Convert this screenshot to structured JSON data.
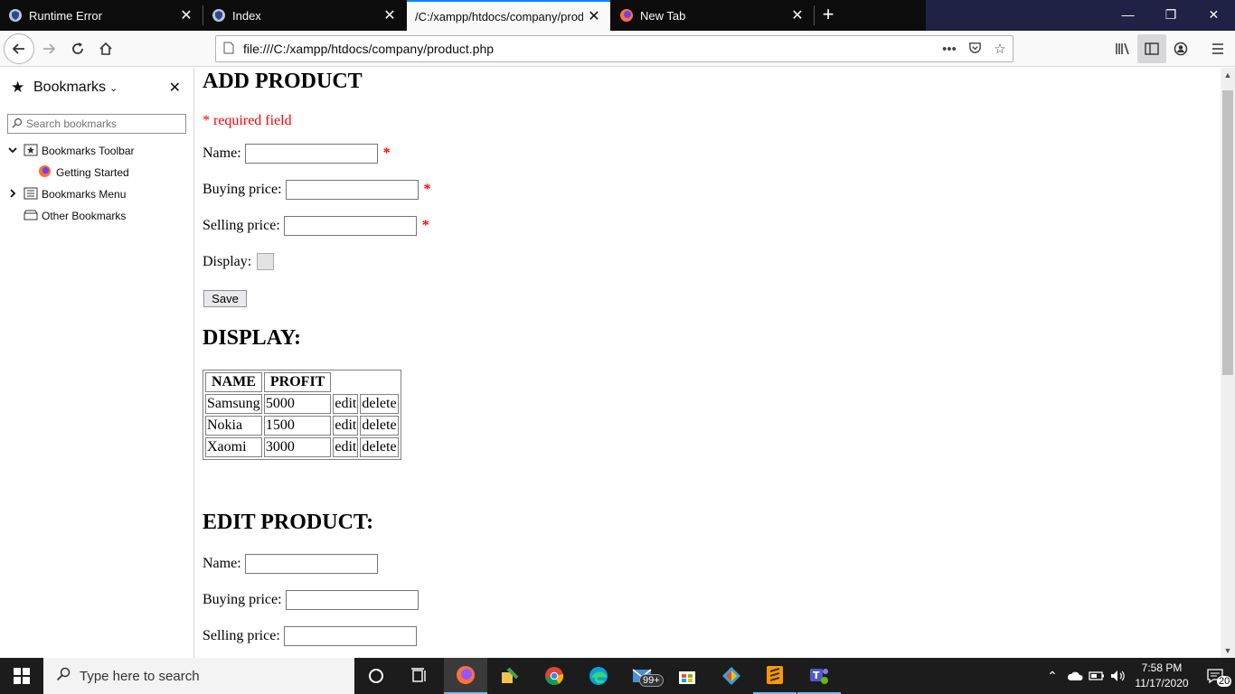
{
  "tabs": [
    {
      "label": "Runtime Error",
      "icon": "shield-icon"
    },
    {
      "label": "Index",
      "icon": "shield-icon"
    },
    {
      "label": "/C:/xampp/htdocs/company/prod",
      "icon": "none",
      "active": true
    },
    {
      "label": "New Tab",
      "icon": "firefox-icon"
    }
  ],
  "window_controls": {
    "minimize": "—",
    "restore": "❐",
    "close": "✕"
  },
  "url": "file:///C:/xampp/htdocs/company/product.php",
  "sidebar": {
    "title": "Bookmarks",
    "search_placeholder": "Search bookmarks",
    "items": [
      {
        "label": "Bookmarks Toolbar"
      },
      {
        "label": "Getting Started"
      },
      {
        "label": "Bookmarks Menu"
      },
      {
        "label": "Other Bookmarks"
      }
    ]
  },
  "page": {
    "add_heading": "ADD PRODUCT",
    "required_note": "* required field",
    "name_label": "Name:",
    "buying_label": "Buying price:",
    "selling_label": "Selling price:",
    "display_label": "Display:",
    "star": "*",
    "save_label": "Save",
    "display_heading": "DISPLAY:",
    "table_headers": [
      "NAME",
      "PROFIT"
    ],
    "rows": [
      {
        "name": "Samsung",
        "profit": "5000",
        "edit": "edit",
        "delete": "delete"
      },
      {
        "name": "Nokia",
        "profit": "1500",
        "edit": "edit",
        "delete": "delete"
      },
      {
        "name": "Xaomi",
        "profit": "3000",
        "edit": "edit",
        "delete": "delete"
      }
    ],
    "edit_heading": "EDIT PRODUCT:",
    "edit_name_label": "Name:",
    "edit_buying_label": "Buying price:",
    "edit_selling_label": "Selling price:"
  },
  "taskbar": {
    "search_placeholder": "Type here to search",
    "mail_badge": "99+",
    "time": "7:58 PM",
    "date": "11/17/2020",
    "notification_count": "20"
  },
  "colors": {
    "accent": "#0a84ff",
    "required": "#ff0000",
    "taskbar": "#1c1c1c"
  }
}
